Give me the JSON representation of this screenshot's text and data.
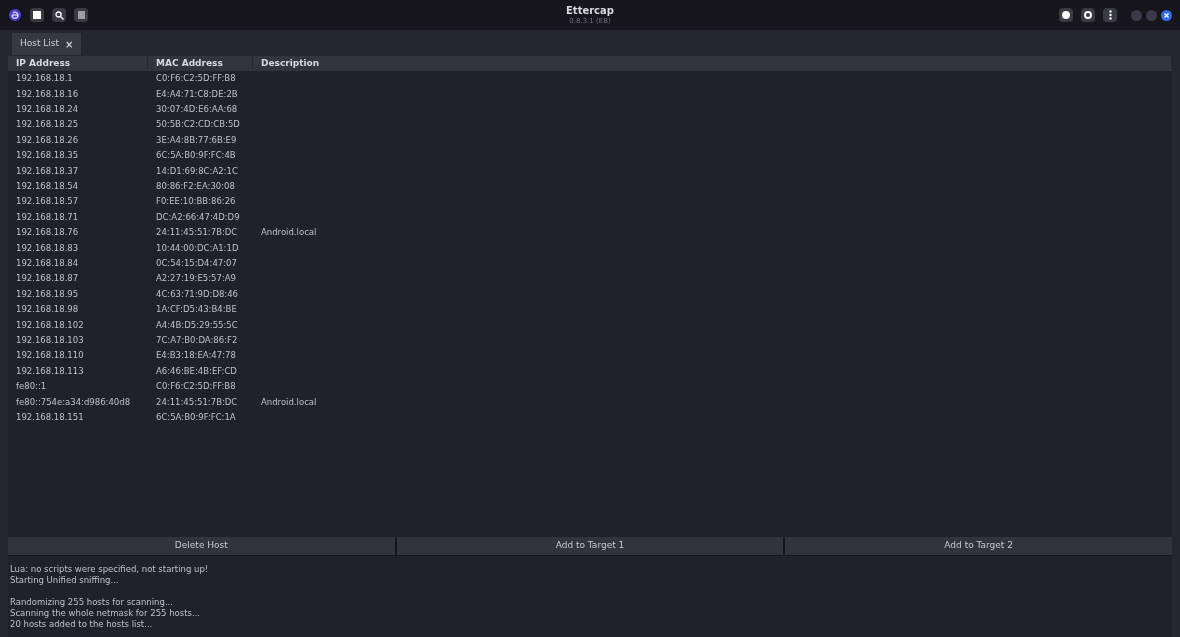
{
  "window": {
    "title": "Ettercap",
    "subtitle": "0.8.3.1 (EB)"
  },
  "tabs": [
    {
      "label": "Host List",
      "close": "×",
      "selected": true
    }
  ],
  "table": {
    "columns": [
      "IP Address",
      "MAC Address",
      "Description"
    ],
    "rows": [
      {
        "ip": "192.168.18.1",
        "mac": "C0:F6:C2:5D:FF:B8"
      },
      {
        "ip": "192.168.18.16",
        "mac": "E4:A4:71:C8:DE:2B"
      },
      {
        "ip": "192.168.18.24",
        "mac": "30:07:4D:E6:AA:68"
      },
      {
        "ip": "192.168.18.25",
        "mac": "50:5B:C2:CD:CB:5D"
      },
      {
        "ip": "192.168.18.26",
        "mac": "3E:A4:8B:77:6B:E9"
      },
      {
        "ip": "192.168.18.35",
        "mac": "6C:5A:B0:9F:FC:4B"
      },
      {
        "ip": "192.168.18.37",
        "mac": "14:D1:69:8C:A2:1C"
      },
      {
        "ip": "192.168.18.54",
        "mac": "80:86:F2:EA:30:08"
      },
      {
        "ip": "192.168.18.57",
        "mac": "F0:EE:10:BB:86:26"
      },
      {
        "ip": "192.168.18.71",
        "mac": "DC:A2:66:47:4D:D9"
      },
      {
        "ip": "192.168.18.76",
        "mac": "24:11:45:51:7B:DC",
        "description": "Android.local"
      },
      {
        "ip": "192.168.18.83",
        "mac": "10:44:00:DC:A1:1D"
      },
      {
        "ip": "192.168.18.84",
        "mac": "0C:54:15:D4:47:07"
      },
      {
        "ip": "192.168.18.87",
        "mac": "A2:27:19:E5:57:A9"
      },
      {
        "ip": "192.168.18.95",
        "mac": "4C:63:71:9D:D8:46"
      },
      {
        "ip": "192.168.18.98",
        "mac": "1A:CF:D5:43:B4:BE"
      },
      {
        "ip": "192.168.18.102",
        "mac": "A4:4B:D5:29:55:5C"
      },
      {
        "ip": "192.168.18.103",
        "mac": "7C:A7:B0:DA:86:F2"
      },
      {
        "ip": "192.168.18.110",
        "mac": "E4:B3:18:EA:47:78"
      },
      {
        "ip": "192.168.18.113",
        "mac": "A6:46:BE:4B:EF:CD"
      },
      {
        "ip": "fe80::1",
        "mac": "C0:F6:C2:5D:FF:B8"
      },
      {
        "ip": "fe80::754e:a34:d986:40d8",
        "mac": "24:11:45:51:7B:DC",
        "description": "Android.local"
      },
      {
        "ip": "192.168.18.151",
        "mac": "6C:5A:B0:9F:FC:1A"
      }
    ]
  },
  "buttons": [
    "Delete Host",
    "Add to Target 1",
    "Add to Target 2"
  ],
  "log": [
    [
      "Lua: no scripts were specified, not starting up!",
      "Starting Unified sniffing..."
    ],
    [
      "Randomizing 255 hosts for scanning...",
      "Scanning the whole netmask for 255 hosts...",
      "20 hosts added to the hosts list..."
    ]
  ]
}
